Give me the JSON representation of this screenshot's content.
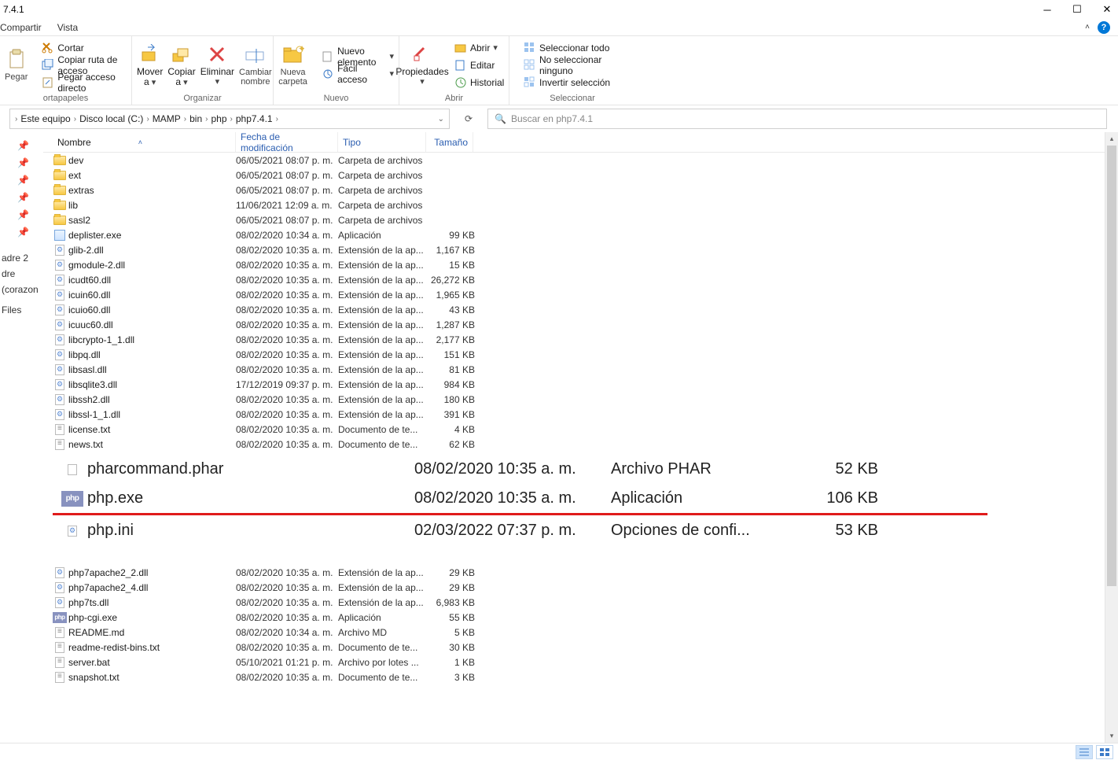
{
  "title": "7.4.1",
  "menu": {
    "compartir": "Compartir",
    "vista": "Vista"
  },
  "ribbon": {
    "portapapeles": {
      "label": "ortapapeles",
      "pegar": "Pegar",
      "cortar": "Cortar",
      "copiar_ruta": "Copiar ruta de acceso",
      "pegar_acceso": "Pegar acceso directo"
    },
    "organizar": {
      "label": "Organizar",
      "mover": "Mover a",
      "copiar": "Copiar a",
      "eliminar": "Eliminar",
      "cambiar": "Cambiar nombre"
    },
    "nuevo": {
      "label": "Nuevo",
      "carpeta": "Nueva carpeta",
      "nuevo_elem": "Nuevo elemento",
      "facil": "Fácil acceso"
    },
    "abrir": {
      "label": "Abrir",
      "propiedades": "Propiedades",
      "abrir": "Abrir",
      "editar": "Editar",
      "historial": "Historial"
    },
    "seleccionar": {
      "label": "Seleccionar",
      "todo": "Seleccionar todo",
      "ninguno": "No seleccionar ninguno",
      "invertir": "Invertir selección"
    }
  },
  "breadcrumb": [
    "Este equipo",
    "Disco local (C:)",
    "MAMP",
    "bin",
    "php",
    "php7.4.1"
  ],
  "search_placeholder": "Buscar en php7.4.1",
  "nav_items": [
    "adre 2",
    "dre",
    "(corazon",
    "",
    "Files",
    ""
  ],
  "columns": {
    "name": "Nombre",
    "date": "Fecha de modificación",
    "type": "Tipo",
    "size": "Tamaño"
  },
  "files_top": [
    {
      "ic": "folder",
      "n": "dev",
      "d": "06/05/2021 08:07 p. m.",
      "t": "Carpeta de archivos",
      "s": ""
    },
    {
      "ic": "folder",
      "n": "ext",
      "d": "06/05/2021 08:07 p. m.",
      "t": "Carpeta de archivos",
      "s": ""
    },
    {
      "ic": "folder",
      "n": "extras",
      "d": "06/05/2021 08:07 p. m.",
      "t": "Carpeta de archivos",
      "s": ""
    },
    {
      "ic": "folder",
      "n": "lib",
      "d": "11/06/2021 12:09 a. m.",
      "t": "Carpeta de archivos",
      "s": ""
    },
    {
      "ic": "folder",
      "n": "sasl2",
      "d": "06/05/2021 08:07 p. m.",
      "t": "Carpeta de archivos",
      "s": ""
    },
    {
      "ic": "exe",
      "n": "deplister.exe",
      "d": "08/02/2020 10:34 a. m.",
      "t": "Aplicación",
      "s": "99 KB"
    },
    {
      "ic": "gear",
      "n": "glib-2.dll",
      "d": "08/02/2020 10:35 a. m.",
      "t": "Extensión de la ap...",
      "s": "1,167 KB"
    },
    {
      "ic": "gear",
      "n": "gmodule-2.dll",
      "d": "08/02/2020 10:35 a. m.",
      "t": "Extensión de la ap...",
      "s": "15 KB"
    },
    {
      "ic": "gear",
      "n": "icudt60.dll",
      "d": "08/02/2020 10:35 a. m.",
      "t": "Extensión de la ap...",
      "s": "26,272 KB"
    },
    {
      "ic": "gear",
      "n": "icuin60.dll",
      "d": "08/02/2020 10:35 a. m.",
      "t": "Extensión de la ap...",
      "s": "1,965 KB"
    },
    {
      "ic": "gear",
      "n": "icuio60.dll",
      "d": "08/02/2020 10:35 a. m.",
      "t": "Extensión de la ap...",
      "s": "43 KB"
    },
    {
      "ic": "gear",
      "n": "icuuc60.dll",
      "d": "08/02/2020 10:35 a. m.",
      "t": "Extensión de la ap...",
      "s": "1,287 KB"
    },
    {
      "ic": "gear",
      "n": "libcrypto-1_1.dll",
      "d": "08/02/2020 10:35 a. m.",
      "t": "Extensión de la ap...",
      "s": "2,177 KB"
    },
    {
      "ic": "gear",
      "n": "libpq.dll",
      "d": "08/02/2020 10:35 a. m.",
      "t": "Extensión de la ap...",
      "s": "151 KB"
    },
    {
      "ic": "gear",
      "n": "libsasl.dll",
      "d": "08/02/2020 10:35 a. m.",
      "t": "Extensión de la ap...",
      "s": "81 KB"
    },
    {
      "ic": "gear",
      "n": "libsqlite3.dll",
      "d": "17/12/2019 09:37 p. m.",
      "t": "Extensión de la ap...",
      "s": "984 KB"
    },
    {
      "ic": "gear",
      "n": "libssh2.dll",
      "d": "08/02/2020 10:35 a. m.",
      "t": "Extensión de la ap...",
      "s": "180 KB"
    },
    {
      "ic": "gear",
      "n": "libssl-1_1.dll",
      "d": "08/02/2020 10:35 a. m.",
      "t": "Extensión de la ap...",
      "s": "391 KB"
    },
    {
      "ic": "txt",
      "n": "license.txt",
      "d": "08/02/2020 10:35 a. m.",
      "t": "Documento de te...",
      "s": "4 KB"
    },
    {
      "ic": "txt",
      "n": "news.txt",
      "d": "08/02/2020 10:35 a. m.",
      "t": "Documento de te...",
      "s": "62 KB"
    }
  ],
  "zoom_rows": [
    {
      "ic": "file",
      "n": "pharcommand.phar",
      "d": "08/02/2020 10:35 a. m.",
      "t": "Archivo PHAR",
      "s": "52 KB"
    },
    {
      "ic": "php",
      "n": "php.exe",
      "d": "08/02/2020 10:35 a. m.",
      "t": "Aplicación",
      "s": "106 KB"
    },
    {
      "ic": "gear",
      "n": "php.ini",
      "d": "02/03/2022 07:37 p. m.",
      "t": "Opciones de confi...",
      "s": "53 KB"
    }
  ],
  "files_bottom": [
    {
      "ic": "gear",
      "n": "php7apache2_2.dll",
      "d": "08/02/2020 10:35 a. m.",
      "t": "Extensión de la ap...",
      "s": "29 KB"
    },
    {
      "ic": "gear",
      "n": "php7apache2_4.dll",
      "d": "08/02/2020 10:35 a. m.",
      "t": "Extensión de la ap...",
      "s": "29 KB"
    },
    {
      "ic": "gear",
      "n": "php7ts.dll",
      "d": "08/02/2020 10:35 a. m.",
      "t": "Extensión de la ap...",
      "s": "6,983 KB"
    },
    {
      "ic": "php",
      "n": "php-cgi.exe",
      "d": "08/02/2020 10:35 a. m.",
      "t": "Aplicación",
      "s": "55 KB"
    },
    {
      "ic": "txt",
      "n": "README.md",
      "d": "08/02/2020 10:34 a. m.",
      "t": "Archivo MD",
      "s": "5 KB"
    },
    {
      "ic": "txt",
      "n": "readme-redist-bins.txt",
      "d": "08/02/2020 10:35 a. m.",
      "t": "Documento de te...",
      "s": "30 KB"
    },
    {
      "ic": "txt",
      "n": "server.bat",
      "d": "05/10/2021 01:21 p. m.",
      "t": "Archivo por lotes ...",
      "s": "1 KB"
    },
    {
      "ic": "txt",
      "n": "snapshot.txt",
      "d": "08/02/2020 10:35 a. m.",
      "t": "Documento de te...",
      "s": "3 KB"
    }
  ]
}
